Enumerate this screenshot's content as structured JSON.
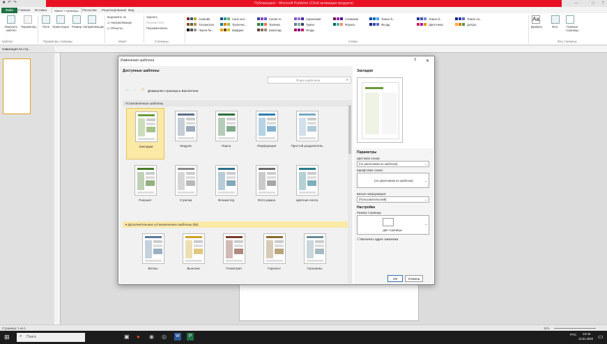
{
  "titlebar": {
    "title": "Публикация1 - Microsoft Publisher (Сбой активации продукта)",
    "qat_icons": [
      "save-icon",
      "undo-icon",
      "redo-icon"
    ],
    "min": "—",
    "max": "□",
    "close": "?"
  },
  "tabs": [
    {
      "label": "Файл",
      "kind": "file"
    },
    {
      "label": "Главная",
      "kind": "normal"
    },
    {
      "label": "Вставка",
      "kind": "normal"
    },
    {
      "label": "Макет страницы",
      "kind": "active"
    },
    {
      "label": "Рассылки",
      "kind": "normal"
    },
    {
      "label": "Рецензирование",
      "kind": "normal"
    },
    {
      "label": "Вид",
      "kind": "normal"
    }
  ],
  "ribbon": {
    "change_template": "Изменить шаблон",
    "params": "Параметры",
    "margins": "Поля",
    "orientation": "Ориентация",
    "size": "Размер",
    "guides": "Направляющие",
    "align_to": "Выровнять по",
    "guides2": "Направляющие",
    "objects": "Объекты",
    "delete": "Удалить",
    "move": "Переместить",
    "rename": "Переименовать",
    "groups": {
      "template": "Шаблон",
      "page_setup": "Параметры страницы",
      "layout": "Макет",
      "pages": "Страницы",
      "schemes": "Схемы",
      "page_bg": "Фон страницы"
    },
    "schemes": [
      {
        "name": "Секвойя",
        "col": 0,
        "row": 0,
        "colors": [
          "#7b2d26",
          "#2a5a8a",
          "#c9a227"
        ]
      },
      {
        "name": "Тосканская",
        "col": 0,
        "row": 1,
        "colors": [
          "#8a4b2a",
          "#556b2f",
          "#b08d57"
        ]
      },
      {
        "name": "Черно-бе...",
        "col": 0,
        "row": 2,
        "colors": [
          "#000000",
          "#555555",
          "#999999"
        ]
      },
      {
        "name": "Сине-зел...",
        "col": 1,
        "row": 0,
        "colors": [
          "#1d4e89",
          "#2a9d8f",
          "#7fb069"
        ]
      },
      {
        "name": "Тропичес...",
        "col": 1,
        "row": 1,
        "colors": [
          "#00838f",
          "#f57c00",
          "#8bc34a"
        ]
      },
      {
        "name": "Шафран",
        "col": 1,
        "row": 2,
        "colors": [
          "#e6a400",
          "#7b3f00",
          "#c9c900"
        ]
      },
      {
        "name": "Синяя яг...",
        "col": 2,
        "row": 0,
        "colors": [
          "#3a3aa0",
          "#8e44ad",
          "#5c5cd6"
        ]
      },
      {
        "name": "Тропика",
        "col": 2,
        "row": 1,
        "colors": [
          "#2e7d32",
          "#00897b",
          "#ff7043"
        ]
      },
      {
        "name": "Шоколад",
        "col": 2,
        "row": 2,
        "colors": [
          "#5d4037",
          "#8d6e63",
          "#a1887f"
        ]
      },
      {
        "name": "Сиреневая",
        "col": 3,
        "row": 0,
        "colors": [
          "#7e57c2",
          "#9575cd",
          "#4527a0"
        ]
      },
      {
        "name": "Туман",
        "col": 3,
        "row": 1,
        "colors": [
          "#607d8b",
          "#90a4ae",
          "#37474f"
        ]
      },
      {
        "name": "Ягоды",
        "col": 3,
        "row": 2,
        "colors": [
          "#ad1457",
          "#6a1b9a",
          "#c2185b"
        ]
      },
      {
        "name": "Сливовая",
        "col": 4,
        "row": 0,
        "colors": [
          "#6a1b4d",
          "#9c27b0",
          "#4a148c"
        ]
      },
      {
        "name": "Форель",
        "col": 4,
        "row": 1,
        "colors": [
          "#00695c",
          "#4db6ac",
          "#ff8a65"
        ]
      },
      {
        "name": "Темно-б...",
        "col": 5,
        "row": 0,
        "colors": [
          "#0d47a1",
          "#1565c0",
          "#42a5f5"
        ]
      },
      {
        "name": "Фьорд",
        "col": 5,
        "row": 1,
        "colors": [
          "#1a237e",
          "#3949ab",
          "#5c6bc0"
        ]
      },
      {
        "name": "Темно-б...",
        "col": 6,
        "row": 0,
        "colors": [
          "#283593",
          "#3f51b5",
          "#7986cb"
        ]
      },
      {
        "name": "Цветочная",
        "col": 6,
        "row": 1,
        "colors": [
          "#d81b60",
          "#8e24aa",
          "#fb8c00"
        ]
      },
      {
        "name": "Темно-си...",
        "col": 7,
        "row": 0,
        "colors": [
          "#1a237e",
          "#303f9f",
          "#5c6bc0"
        ]
      },
      {
        "name": "Цитрус",
        "col": 7,
        "row": 1,
        "colors": [
          "#f9a825",
          "#ef6c00",
          "#43a047"
        ]
      }
    ],
    "fonts": "Шрифты",
    "background": "Фон",
    "master_pages": "Главные страницы"
  },
  "nav": {
    "header": "Навигация по стр..."
  },
  "dialog": {
    "title": "Изменение шаблона",
    "help": "?",
    "close": "✕",
    "available": "Доступные шаблоны",
    "search_placeholder": "Поиск шаблонов",
    "breadcrumb_home": "Домашняя страница",
    "breadcrumb_sep": "▸",
    "breadcrumb_current": "Бюллетени",
    "installed": "Установленные шаблоны",
    "more_installed": "Дополнительные установленные шаблоны (55)",
    "templates": [
      {
        "name": "Закладки",
        "selected": true,
        "accent": "#6a9a3a"
      },
      {
        "name": "Модули",
        "selected": false,
        "accent": "#5a6f8a"
      },
      {
        "name": "Парча",
        "selected": false,
        "accent": "#2f6e3a"
      },
      {
        "name": "Перфорация",
        "selected": false,
        "accent": "#2e7db0"
      },
      {
        "name": "Простой разделитель",
        "selected": false,
        "accent": "#7aa6c2"
      },
      {
        "name": "Рикошет",
        "selected": false,
        "accent": "#4b7b2a"
      },
      {
        "name": "Стрелки",
        "selected": false,
        "accent": "#8a8a8a"
      },
      {
        "name": "Фломастер",
        "selected": false,
        "accent": "#2f6e8a"
      },
      {
        "name": "Фото-рамка",
        "selected": false,
        "accent": "#6b6b6b"
      },
      {
        "name": "Цветная лента",
        "selected": false,
        "accent": "#2a7a8a"
      }
    ],
    "more_templates": [
      {
        "name": "Волны",
        "accent": "#5a7a9a"
      },
      {
        "name": "Выноски",
        "accent": "#c9a227"
      },
      {
        "name": "Геометрия",
        "accent": "#7a3a2a"
      },
      {
        "name": "Горизонт",
        "accent": "#8a6a2a"
      },
      {
        "name": "Горошины",
        "accent": "#6a8a9a"
      }
    ],
    "preview_title": "Закладки",
    "params_title": "Параметры",
    "color_scheme_label": "Цветовая схема:",
    "color_scheme_value": "(по умолчанию из шаблона)",
    "font_scheme_label": "Шрифтовая схема:",
    "font_scheme_value": "(по умолчанию из шаблона)",
    "biz_label": "Бизнес-информация:",
    "biz_value": "(Пользовательский)",
    "setup_title": "Настройка",
    "page_size_label": "Размер страницы",
    "page_size_value": "две страницы",
    "customer_address": "Включить адрес заказчика",
    "ok": "ОК",
    "cancel": "Отмена"
  },
  "status": {
    "page": "Страница: 1 из 1",
    "zoom": "11%",
    "time": "13:44",
    "lang": "РУС",
    "date": "12.01.2020"
  },
  "taskbar": {
    "search_placeholder": "Поиск"
  }
}
